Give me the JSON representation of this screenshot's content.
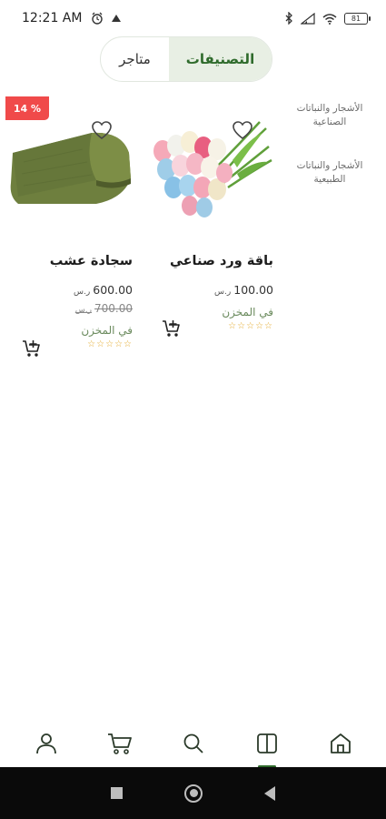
{
  "status_bar": {
    "time": "12:21 AM",
    "battery": "81"
  },
  "tabs": {
    "categories": "التصنيفات",
    "stores": "متاجر"
  },
  "categories": [
    {
      "label": "الأشجار والنباتات الصناعية"
    },
    {
      "label": "الأشجار والنباتات الطبيعية"
    }
  ],
  "products": [
    {
      "name": "باقة ورد صناعي",
      "price": "100.00",
      "currency": "ر.س",
      "stock": "في المخزن",
      "stars": "☆☆☆☆☆"
    },
    {
      "name": "سجادة عشب",
      "price": "600.00",
      "currency": "ر.س",
      "old_price": "700.00",
      "old_currency": "ر.س",
      "discount": "14 %",
      "stock": "في المخزن",
      "stars": "☆☆☆☆☆"
    }
  ],
  "colors": {
    "accent": "#2f6b2c",
    "discount": "#f04a4a",
    "stars": "#e3a92b"
  },
  "icons": {
    "favorite": "heart-icon",
    "add_to_cart": "cart-plus-icon",
    "nav": [
      "profile-icon",
      "cart-icon",
      "search-icon",
      "categories-icon",
      "home-icon"
    ]
  }
}
